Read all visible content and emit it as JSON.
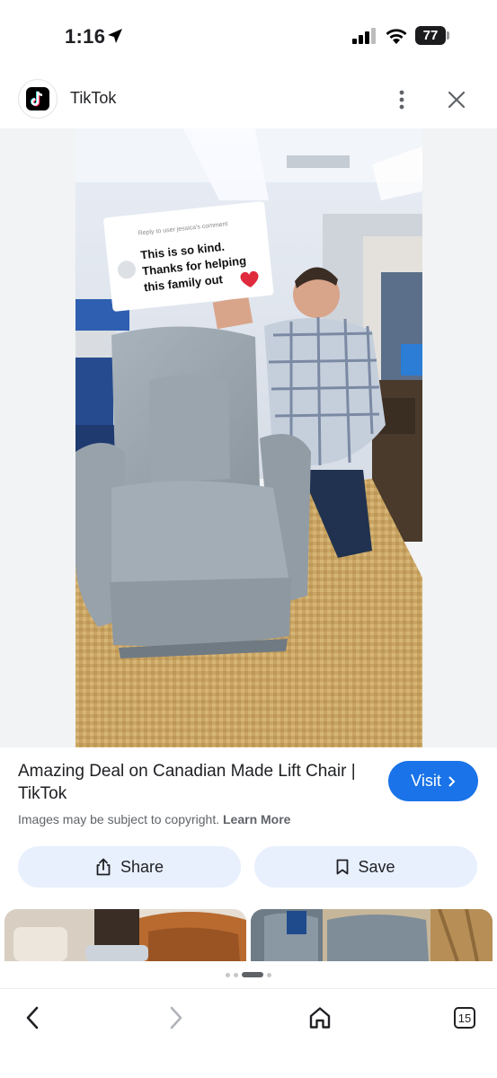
{
  "status_bar": {
    "time": "1:16",
    "battery": "77",
    "icons": [
      "location-arrow-icon",
      "signal-icon",
      "wifi-icon",
      "battery-icon"
    ]
  },
  "source": {
    "name": "TikTok",
    "logo_icon": "tiktok-logo-icon"
  },
  "image": {
    "overlay_reply": "Reply to user jessica's comment",
    "overlay_line1": "This is so kind.",
    "overlay_line2": "Thanks for helping",
    "overlay_line3": "this family out"
  },
  "result": {
    "title": "Amazing Deal on Canadian Made Lift Chair | TikTok",
    "visit_label": "Visit",
    "copyright_text": "Images may be subject to copyright.",
    "learn_more": "Learn More"
  },
  "actions": {
    "share_label": "Share",
    "save_label": "Save"
  },
  "pager": {
    "count": 4,
    "active_index": 2
  },
  "browser": {
    "tab_count": "15"
  },
  "colors": {
    "accent": "#1a73e8",
    "action_bg": "#e8f0fe",
    "viewer_bg": "#f1f3f4"
  }
}
